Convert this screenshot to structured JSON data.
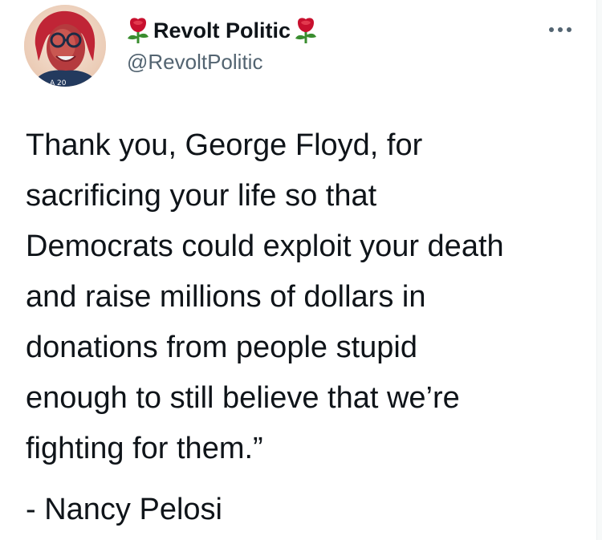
{
  "tweet": {
    "display_name": "Revolt Politic",
    "handle": "@RevoltPolitic",
    "name_emoji": "rose-icon",
    "more_icon": "more-horizontal-icon",
    "avatar_icon": "profile-avatar-icon",
    "body_lines": [
      "Thank you, George Floyd, for",
      "sacrificing your life so that",
      "Democrats could exploit your death",
      "and raise millions of dollars in",
      "donations from people stupid",
      "enough to still believe that we’re",
      "fighting for them.”"
    ],
    "attribution": "- Nancy Pelosi"
  },
  "colors": {
    "text_primary": "#0f1419",
    "text_secondary": "#536471",
    "rose_red": "#c8102e",
    "rose_leaf": "#3a8d2f",
    "background": "#ffffff"
  }
}
